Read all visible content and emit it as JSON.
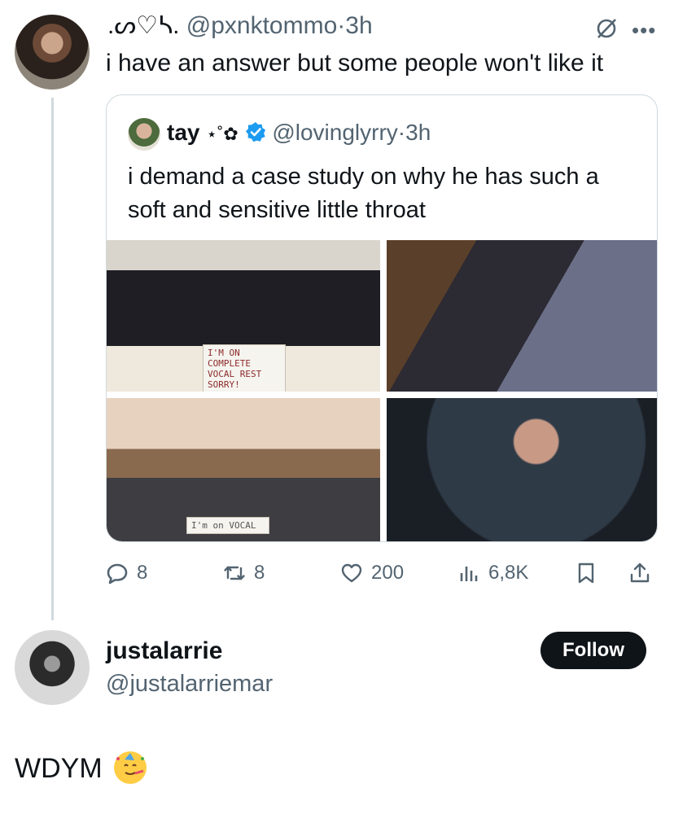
{
  "tweet": {
    "display_name": ".ᔕ♡ᓴ.",
    "handle": "@pxnktommo",
    "separator": "·",
    "time": "3h",
    "text": "i have an answer but some people won't like it",
    "more_icon": "more-horizontal-icon",
    "grok_icon": "grok-icon"
  },
  "quote": {
    "display_name": "tay",
    "decoration": "⋆˚✿",
    "handle": "@lovinglyrry",
    "separator": "·",
    "time": "3h",
    "text": "i demand a case study on why he has such a soft and sensitive little throat",
    "verified_color": "#1d9bf0",
    "media": [
      {
        "sign_text": "I'M ON COMPLETE VOCAL REST SORRY!"
      },
      {
        "sign_text": ""
      },
      {
        "sign_text": "I'm on VOCAL"
      },
      {
        "sign_text": ""
      }
    ]
  },
  "actions": {
    "replies": "8",
    "reposts": "8",
    "likes": "200",
    "views": "6,8K"
  },
  "reply": {
    "display_name": "justalarrie",
    "handle": "@justalarriemar",
    "follow_label": "Follow",
    "text": "WDYM"
  },
  "colors": {
    "text": "#0f1419",
    "muted": "#536471",
    "border": "#cfd9de",
    "accent": "#1d9bf0"
  }
}
